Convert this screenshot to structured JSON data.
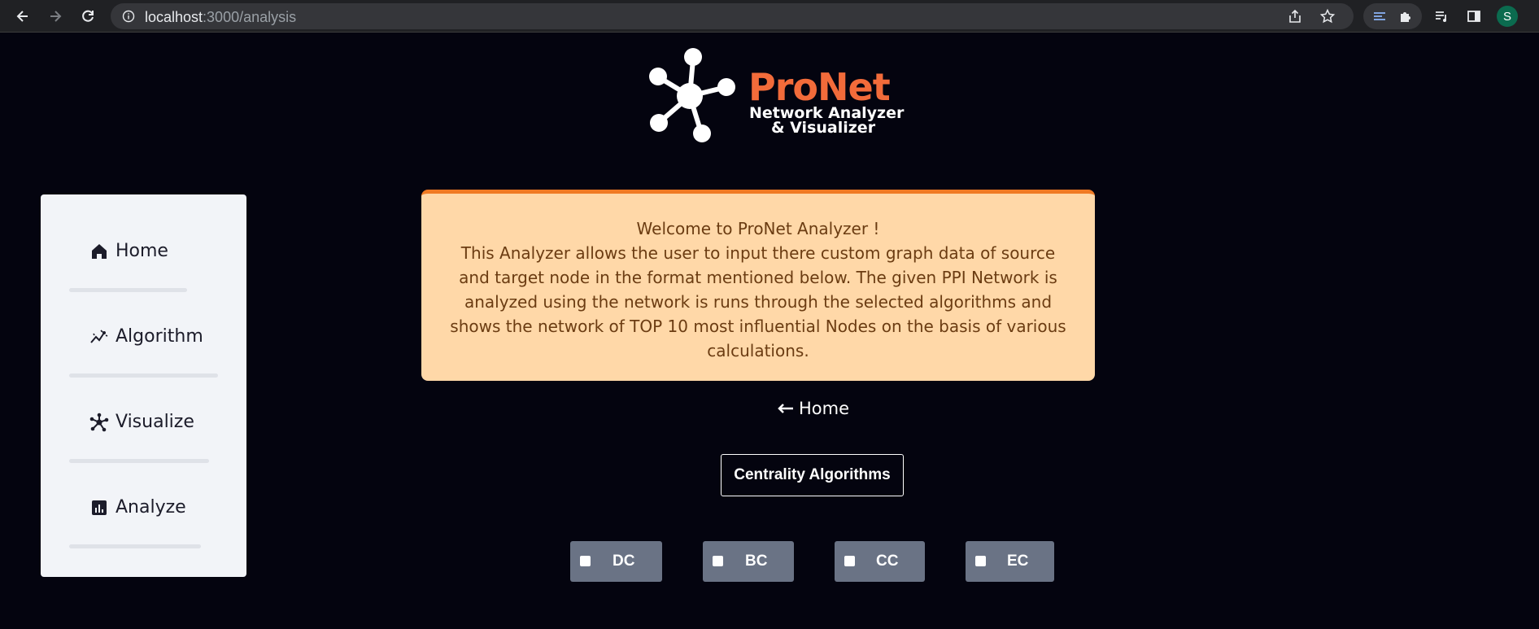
{
  "browser": {
    "url_host": "localhost",
    "url_path": ":3000/analysis",
    "profile_initial": "S"
  },
  "logo": {
    "title": "ProNet",
    "subtitle_line1": "Network Analyzer",
    "subtitle_line2": "& Visualizer"
  },
  "sidebar": {
    "items": [
      {
        "label": "Home",
        "icon": "home-icon"
      },
      {
        "label": "Algorithm",
        "icon": "chart-line-icon"
      },
      {
        "label": "Visualize",
        "icon": "network-icon"
      },
      {
        "label": "Analyze",
        "icon": "bar-chart-icon"
      }
    ]
  },
  "welcome": {
    "heading": "Welcome to ProNet Analyzer !",
    "line1": "This Analyzer allows the user to input there custom graph data of source",
    "line2": "and target node in the format mentioned below. The given PPI Network is",
    "line3": "analyzed using the network is runs through the selected algorithms and",
    "line4": "shows the network of TOP 10 most influential Nodes on the basis of various",
    "line5": "calculations."
  },
  "home_link": {
    "label": "Home",
    "icon": "arrow-left-icon"
  },
  "centrality_button": "Centrality Algorithms",
  "algorithms": [
    {
      "label": "DC",
      "checked": false
    },
    {
      "label": "BC",
      "checked": false
    },
    {
      "label": "CC",
      "checked": false
    },
    {
      "label": "EC",
      "checked": false
    }
  ],
  "colors": {
    "background": "#04040f",
    "brand": "#f26b3a",
    "welcome_bg": "#ffd8a8",
    "welcome_border": "#f07a24",
    "chip_bg": "#6a7385"
  }
}
